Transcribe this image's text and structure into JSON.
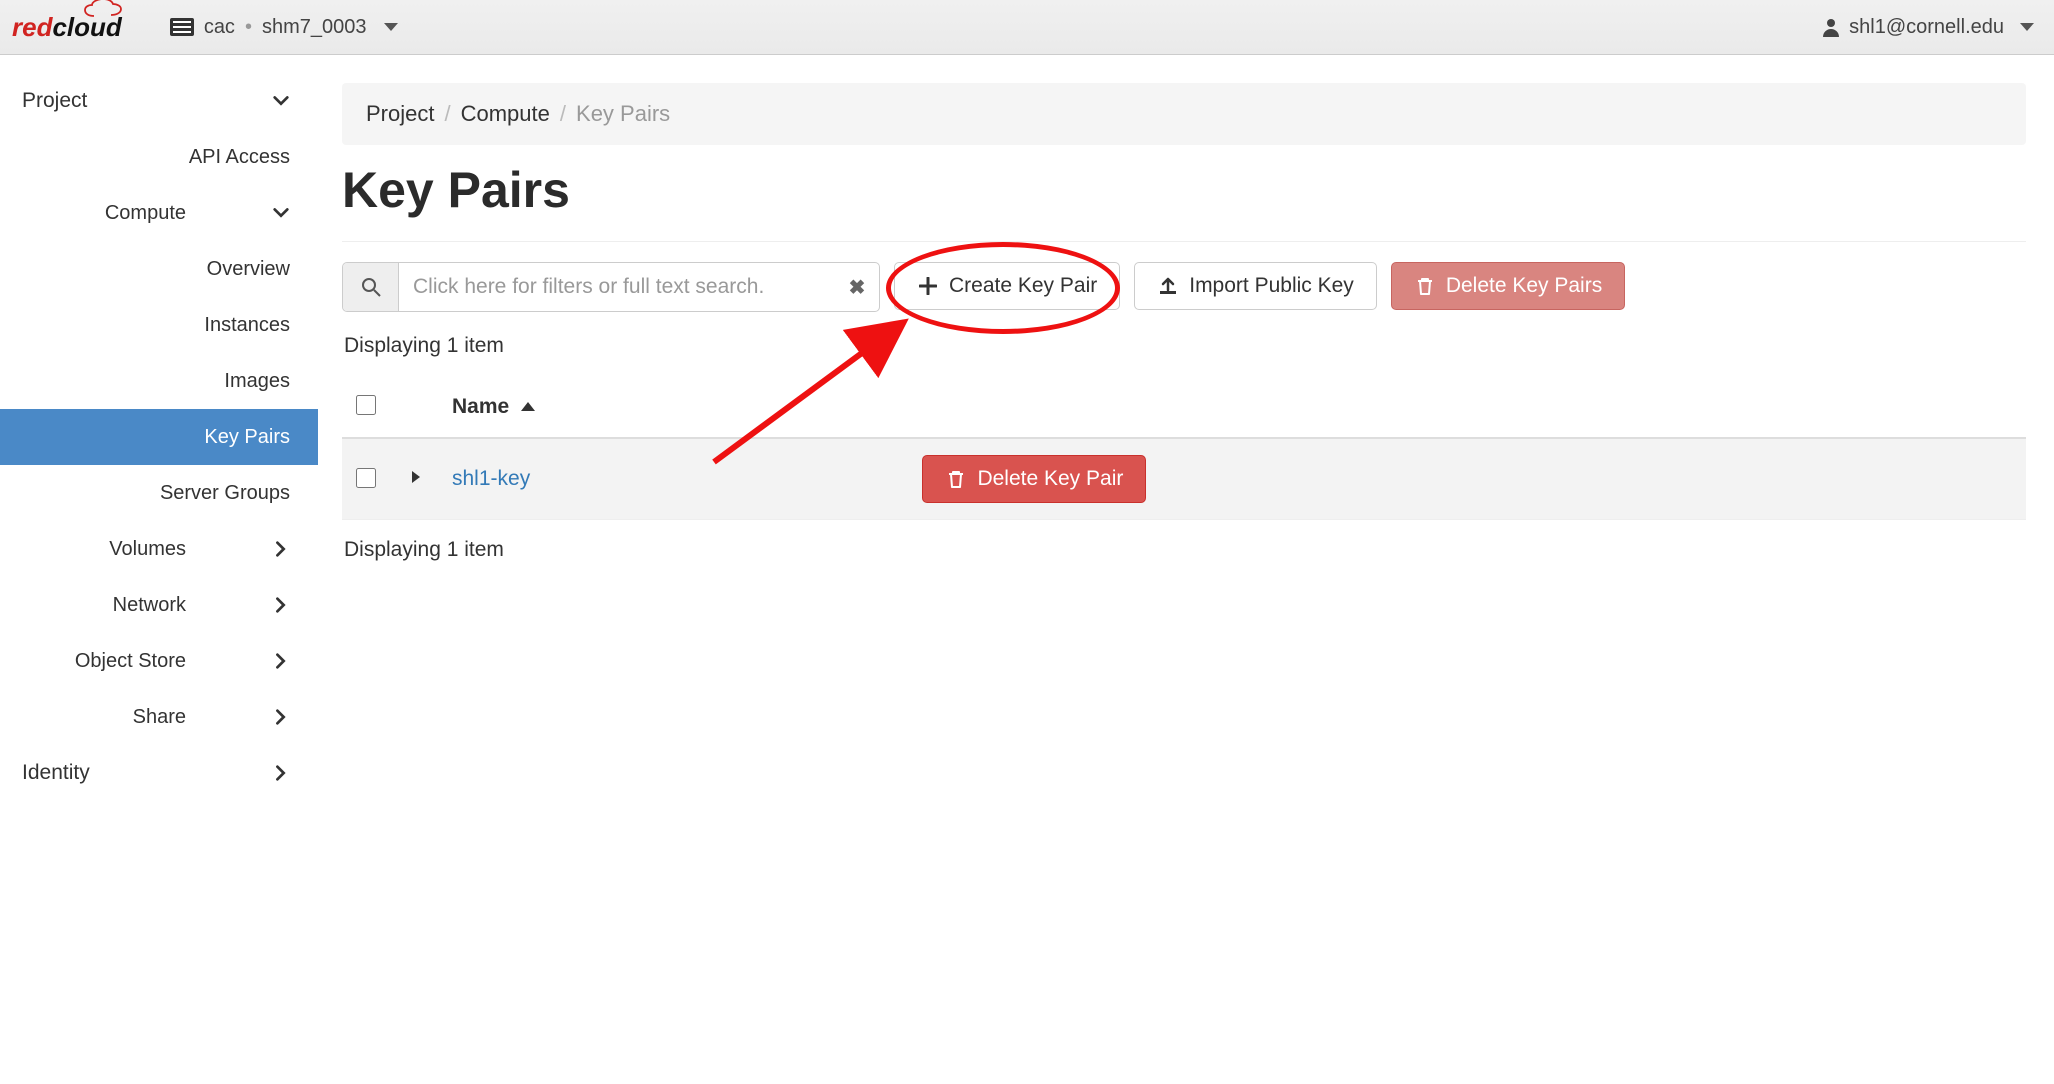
{
  "topbar": {
    "project_org": "cac",
    "project_name": "shm7_0003",
    "user": "shl1@cornell.edu"
  },
  "logo": {
    "red": "red",
    "cloud": "cloud"
  },
  "nav": {
    "project": {
      "label": "Project"
    },
    "api_access": {
      "label": "API Access"
    },
    "compute": {
      "label": "Compute",
      "items": {
        "overview": "Overview",
        "instances": "Instances",
        "images": "Images",
        "key_pairs": "Key Pairs",
        "server_groups": "Server Groups"
      }
    },
    "volumes": {
      "label": "Volumes"
    },
    "network": {
      "label": "Network"
    },
    "object_store": {
      "label": "Object Store"
    },
    "share": {
      "label": "Share"
    },
    "identity": {
      "label": "Identity"
    }
  },
  "breadcrumb": {
    "project": "Project",
    "compute": "Compute",
    "current": "Key Pairs"
  },
  "page": {
    "title": "Key Pairs"
  },
  "toolbar": {
    "search_placeholder": "Click here for filters or full text search.",
    "create_label": "Create Key Pair",
    "import_label": "Import Public Key",
    "delete_many_label": "Delete Key Pairs"
  },
  "table": {
    "count_text_top": "Displaying 1 item",
    "count_text_bottom": "Displaying 1 item",
    "header_name": "Name",
    "rows": [
      {
        "name": "shl1-key",
        "delete_label": "Delete Key Pair"
      }
    ]
  }
}
